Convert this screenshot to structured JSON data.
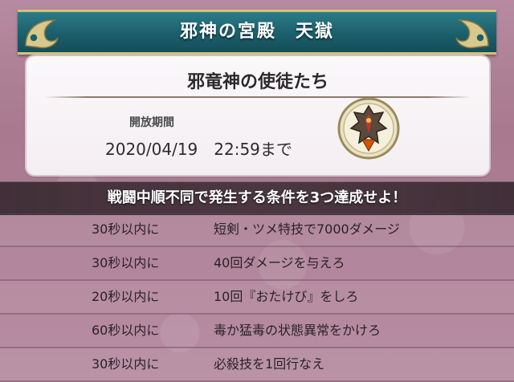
{
  "header": {
    "title": "邪神の宮殿　天獄"
  },
  "card": {
    "title": "邪竜神の使徒たち",
    "period_label": "開放期間",
    "period_value": "2020/04/19　22:59まで",
    "emblem_icon": "boss-emblem-icon"
  },
  "instruction": {
    "text": "戦闘中順不同で発生する条件を3つ達成せよ！"
  },
  "conditions": [
    {
      "time": "30秒以内に",
      "task": "短剣・ツメ特技で7000ダメージ"
    },
    {
      "time": "30秒以内に",
      "task": "40回ダメージを与えろ"
    },
    {
      "time": "20秒以内に",
      "task": "10回『おたけび』をしろ"
    },
    {
      "time": "60秒以内に",
      "task": "毒か猛毒の状態異常をかけろ"
    },
    {
      "time": "30秒以内に",
      "task": "必殺技を1回行なえ"
    }
  ],
  "colors": {
    "header_teal": "#1b5f6b",
    "header_border_gold": "#d4c27a",
    "background_mauve": "#b68aa0",
    "card_bg": "#f6f1f4",
    "instruction_bar": "#4a363f"
  }
}
